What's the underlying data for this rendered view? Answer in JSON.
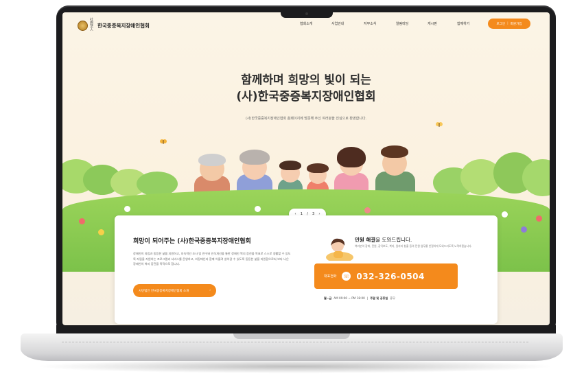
{
  "header": {
    "logo_text": "한국중증복지장애인협회",
    "logo_mini": "社團法人",
    "nav": [
      "협회소개",
      "사업안내",
      "지부소식",
      "알림마당",
      "게시판",
      "함께하기"
    ],
    "login_label": "로그인",
    "signup_label": "회원가입"
  },
  "hero": {
    "title_line1": "함께하며 희망의 빛이 되는",
    "title_line2": "(사)한국중증복지장애인협회",
    "subtitle": "(사)한국중증복지장애인협회 홈페이지에 방문해 주신 여러분을 진심으로 환영합니다.",
    "pager": {
      "prev": "‹",
      "current": "1",
      "total": "3",
      "next": "›"
    }
  },
  "intro": {
    "title": "희망이 되어주는 (사)한국중증복지장애인협회",
    "desc": "장애인의 자립과 동등한 삶을 지원하고, 지속적인 조사 및 연구와 인식개선을 통한 장애인 복지 증진을 목표로 스스로 생활할 수 있도록 자립을 지원하는 프로그램과 서비스를 운영하고, 비장애인과 함께 어울려 살아갈 수 있도록 동등한 삶을 지원함으로써 보다 나은 장애인의 복지 증진을 목적으로 합니다.",
    "button_label": "사단법인 한국중증복지장애인협회 소개",
    "button_arrow": "›"
  },
  "help": {
    "title_bold": "민원 해결",
    "title_rest": "을 도와드립니다.",
    "desc": "여러분의 장애, 민원, 공익보도, 복지, 일자리 창출 등의 민원 업무를 친절하게 도와드리도록 노력하겠습니다.",
    "phone_label": "대표전화",
    "phone_number": "032-326-0504",
    "hours_days": "월~금",
    "hours_time": "AM 09:00 ~ PM 18:00",
    "hours_sep": "|",
    "hours_weekend": "주말 및 공휴일",
    "hours_weekend_status": "휴무"
  },
  "colors": {
    "accent": "#f48a1c",
    "hero_bg": "#fbf4e6",
    "grass": "#8dcb52",
    "bezel": "#1c1c1e"
  }
}
